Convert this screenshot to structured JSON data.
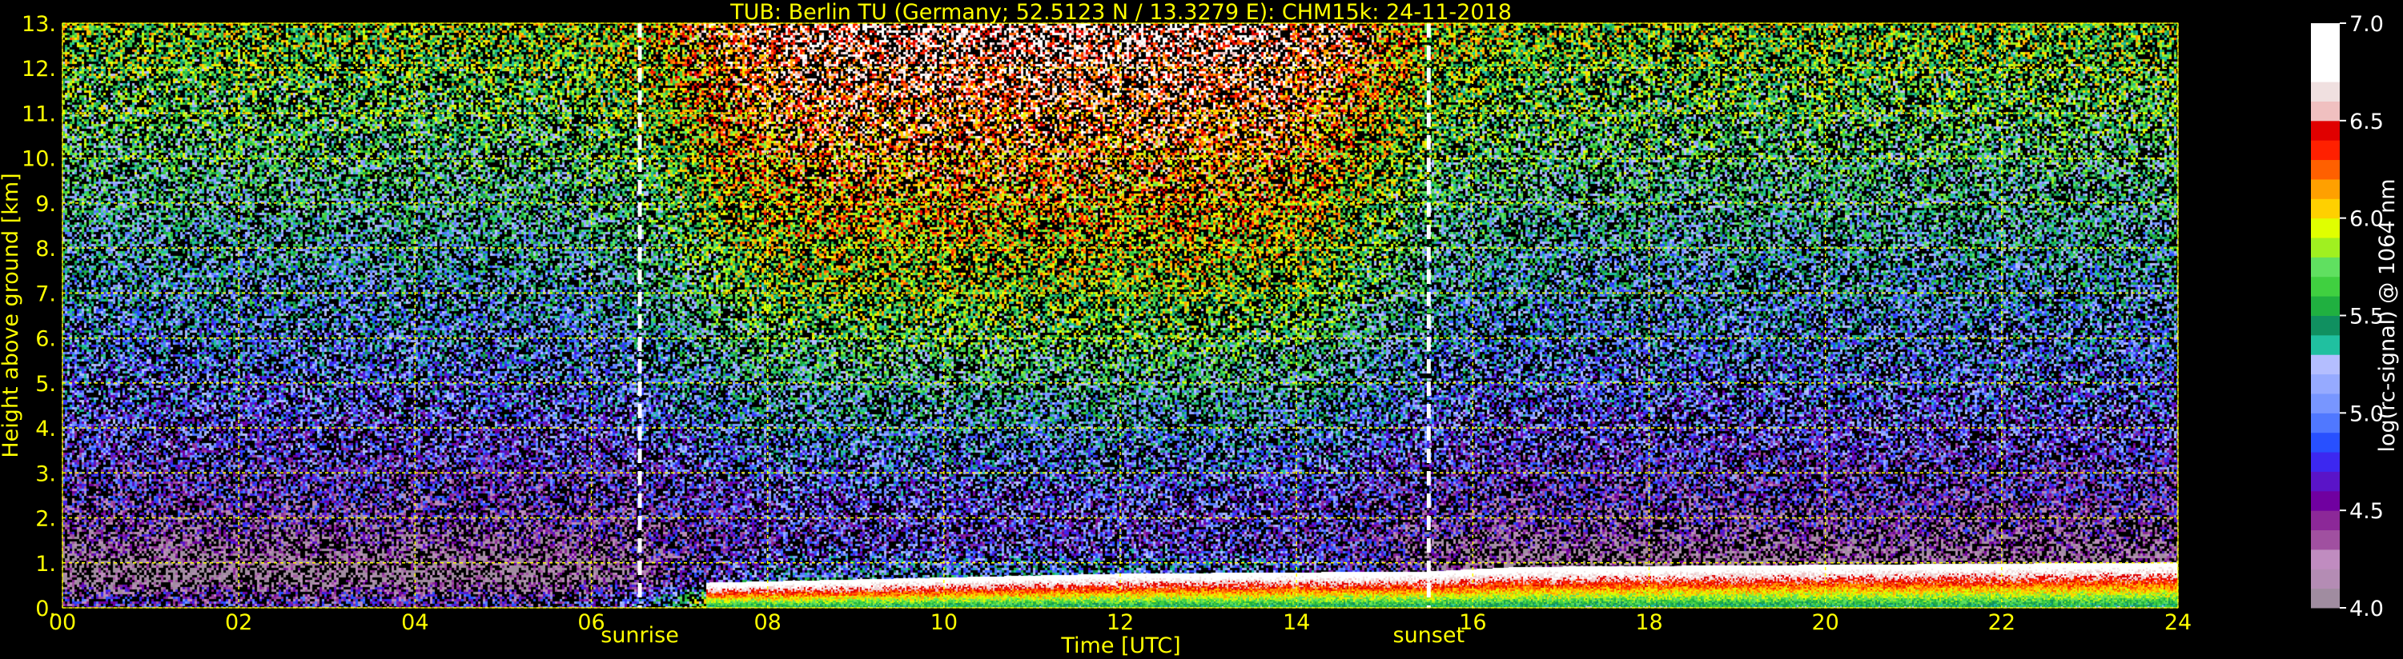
{
  "chart_data": {
    "type": "heatmap",
    "title": "TUB: Berlin TU (Germany; 52.5123 N / 13.3279 E):    CHM15k: 24-11-2018",
    "xlabel": "Time [UTC]",
    "ylabel": "Height above ground [km]",
    "xlim": [
      0,
      24
    ],
    "ylim": [
      0,
      13
    ],
    "x_ticks": [
      "00",
      "02",
      "04",
      "06",
      "08",
      "10",
      "12",
      "14",
      "16",
      "18",
      "20",
      "22",
      "24"
    ],
    "y_ticks": [
      "0.",
      "1.",
      "2.",
      "3.",
      "4.",
      "5.",
      "6.",
      "7.",
      "8.",
      "9.",
      "10.",
      "11.",
      "12.",
      "13."
    ],
    "grid": true,
    "annotations": [
      {
        "label": "sunrise",
        "x": 6.55
      },
      {
        "label": "sunset",
        "x": 15.5
      }
    ],
    "colorbar": {
      "label": "log(rc-signal) @ 1064 nm",
      "range": [
        4.0,
        7.0
      ],
      "ticks": [
        "4.0",
        "4.5",
        "5.0",
        "5.5",
        "6.0",
        "6.5",
        "7.0"
      ],
      "colors": [
        "#a08ca0",
        "#b48cb4",
        "#c08cc0",
        "#a050a0",
        "#8c2898",
        "#7000a0",
        "#5a14c8",
        "#3c28f0",
        "#2850ff",
        "#5078ff",
        "#7896ff",
        "#96aaff",
        "#b4beff",
        "#20c0a0",
        "#109060",
        "#20b040",
        "#40d040",
        "#60e060",
        "#a0f020",
        "#e0ff00",
        "#ffd000",
        "#ffa000",
        "#ff6000",
        "#ff2000",
        "#e00000",
        "#f0c0c0",
        "#f0e0e0",
        "#ffffff",
        "#ffffff",
        "#ffffff"
      ]
    },
    "profile": [
      {
        "z": 0.2,
        "night": 4.6,
        "day": 6.6
      },
      {
        "z": 0.7,
        "night": 4.0,
        "day": 5.2
      },
      {
        "z": 1.5,
        "night": 4.3,
        "day": 4.8
      },
      {
        "z": 2.5,
        "night": 4.6,
        "day": 4.9
      },
      {
        "z": 3.5,
        "night": 4.8,
        "day": 5.1
      },
      {
        "z": 5.0,
        "night": 5.0,
        "day": 5.4
      },
      {
        "z": 7.0,
        "night": 5.2,
        "day": 5.8
      },
      {
        "z": 9.0,
        "night": 5.4,
        "day": 6.1
      },
      {
        "z": 11.0,
        "night": 5.6,
        "day": 6.4
      },
      {
        "z": 13.0,
        "night": 5.8,
        "day": 6.7
      }
    ],
    "boundary_layer": [
      {
        "x": 7.3,
        "top": 0.55
      },
      {
        "x": 12.0,
        "top": 0.75
      },
      {
        "x": 15.5,
        "top": 0.8
      },
      {
        "x": 16.5,
        "top": 0.9
      },
      {
        "x": 24.0,
        "top": 1.0
      }
    ]
  }
}
